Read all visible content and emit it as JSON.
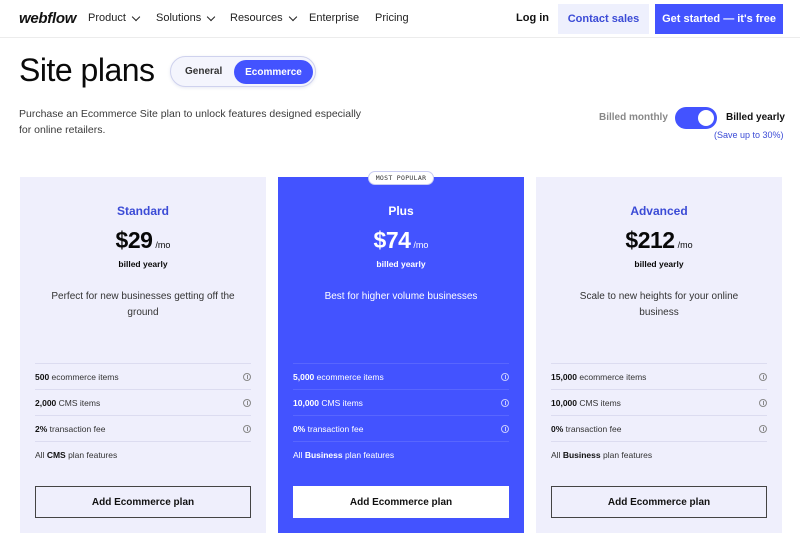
{
  "nav": {
    "logo": "webflow",
    "items": [
      {
        "label": "Product",
        "dropdown": true
      },
      {
        "label": "Solutions",
        "dropdown": true
      },
      {
        "label": "Resources",
        "dropdown": true
      },
      {
        "label": "Enterprise",
        "dropdown": false
      },
      {
        "label": "Pricing",
        "dropdown": false
      }
    ],
    "login": "Log in",
    "contact_sales": "Contact sales",
    "get_started": "Get started — it's free"
  },
  "header": {
    "title": "Site plans",
    "tabs": [
      {
        "label": "General",
        "active": false
      },
      {
        "label": "Ecommerce",
        "active": true
      }
    ],
    "description": "Purchase an Ecommerce Site plan to unlock features designed especially for online retailers.",
    "billing": {
      "monthly_label": "Billed monthly",
      "yearly_label": "Billed yearly",
      "yearly_selected": true,
      "save_note": "(Save up to 30%)"
    }
  },
  "plans": [
    {
      "name": "Standard",
      "price": "$29",
      "per": "/mo",
      "billed": "billed yearly",
      "tagline": "Perfect for new businesses getting off the ground",
      "popular": false,
      "features": [
        {
          "strong": "500",
          "text": " ecommerce items",
          "info": true
        },
        {
          "strong": "2,000",
          "text": " CMS items",
          "info": true
        },
        {
          "strong": "2%",
          "text": " transaction fee",
          "info": true
        },
        {
          "pre": "All ",
          "strong": "CMS",
          "text": " plan features",
          "info": false
        }
      ],
      "cta": "Add Ecommerce plan"
    },
    {
      "name": "Plus",
      "badge": "MOST POPULAR",
      "price": "$74",
      "per": "/mo",
      "billed": "billed yearly",
      "tagline": "Best for higher volume businesses",
      "popular": true,
      "features": [
        {
          "strong": "5,000",
          "text": " ecommerce items",
          "info": true
        },
        {
          "strong": "10,000",
          "text": " CMS items",
          "info": true
        },
        {
          "strong": "0%",
          "text": " transaction fee",
          "info": true
        },
        {
          "pre": "All ",
          "strong": "Business",
          "text": " plan features",
          "info": false
        }
      ],
      "cta": "Add Ecommerce plan"
    },
    {
      "name": "Advanced",
      "price": "$212",
      "per": "/mo",
      "billed": "billed yearly",
      "tagline": "Scale to new heights for your online business",
      "popular": false,
      "features": [
        {
          "strong": "15,000",
          "text": " ecommerce items",
          "info": true
        },
        {
          "strong": "10,000",
          "text": " CMS items",
          "info": true
        },
        {
          "strong": "0%",
          "text": " transaction fee",
          "info": true
        },
        {
          "pre": "All ",
          "strong": "Business",
          "text": " plan features",
          "info": false
        }
      ],
      "cta": "Add Ecommerce plan"
    }
  ],
  "colors": {
    "accent": "#4353ff",
    "accent_text": "#3b4bd6",
    "card_bg": "#efeffc",
    "contact_bg": "#eef0fd"
  }
}
